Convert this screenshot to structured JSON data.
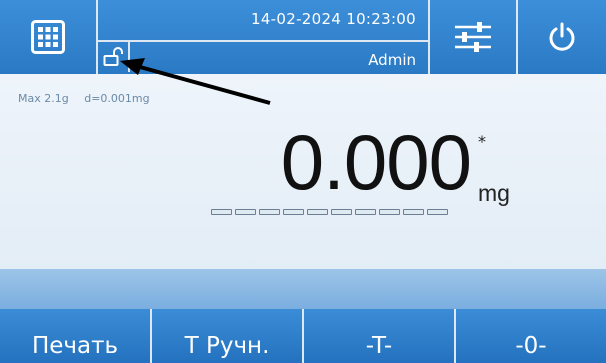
{
  "header": {
    "menu_icon": "grid-menu-icon",
    "datetime": "14-02-2024 10:23:00",
    "user": "Admin",
    "lock_icon": "unlocked-padlock-icon",
    "settings_icon": "sliders-icon",
    "power_icon": "power-icon"
  },
  "specs": {
    "max": "Max 2.1g",
    "d": "d=0.001mg"
  },
  "display": {
    "value": "0.000",
    "unit": "mg",
    "stability_marker": "*",
    "segment_count": 10
  },
  "softkeys": [
    {
      "label": "Печать"
    },
    {
      "label": "Т Ручн."
    },
    {
      "label": "-T-"
    },
    {
      "label": "-0-"
    }
  ],
  "colors": {
    "accent": "#2a79c4",
    "background": "#e9f1f8"
  }
}
